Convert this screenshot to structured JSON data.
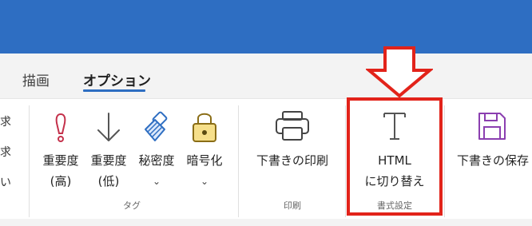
{
  "tabs": {
    "draw": "描画",
    "options": "オプション"
  },
  "left_cut": [
    "求",
    "求",
    "い"
  ],
  "tag_group": {
    "label": "タグ",
    "buttons": [
      {
        "line1": "重要度",
        "line2": "(高)",
        "icon": "exclamation-icon"
      },
      {
        "line1": "重要度",
        "line2": "(低)",
        "icon": "arrow-down-icon"
      },
      {
        "line1": "秘密度",
        "line2": "⌄",
        "icon": "brush-icon"
      },
      {
        "line1": "暗号化",
        "line2": "⌄",
        "icon": "lock-icon"
      }
    ]
  },
  "print_group": {
    "label": "印刷",
    "button": {
      "line1": "下書きの印刷",
      "icon": "printer-icon"
    }
  },
  "format_group": {
    "label": "書式設定",
    "button": {
      "line1": "HTML",
      "line2": "に切り替え",
      "icon": "text-format-icon"
    }
  },
  "save_group": {
    "button": {
      "line1": "下書きの保存",
      "icon": "save-icon"
    }
  },
  "colors": {
    "titlebar": "#2e6ec2",
    "highlight": "#e2231a",
    "exclamation": "#c4314b",
    "accent_blue": "#2e6ec2"
  }
}
